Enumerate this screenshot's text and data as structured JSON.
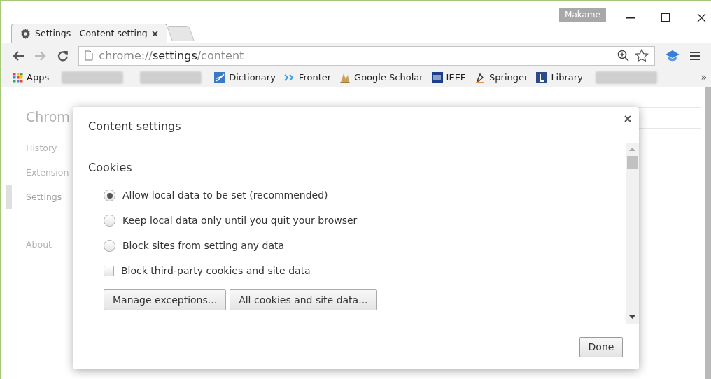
{
  "window": {
    "profile": "Makame"
  },
  "tab": {
    "title": "Settings - Content setting"
  },
  "address": {
    "scheme": "chrome://",
    "host": "settings",
    "path": "/content"
  },
  "bookmarks": [
    {
      "kind": "apps",
      "label": "Apps"
    },
    {
      "kind": "redacted"
    },
    {
      "kind": "redacted"
    },
    {
      "kind": "link",
      "label": "Dictionary"
    },
    {
      "kind": "link",
      "label": "Fronter"
    },
    {
      "kind": "link",
      "label": "Google Scholar"
    },
    {
      "kind": "link",
      "label": "IEEE"
    },
    {
      "kind": "link",
      "label": "Springer"
    },
    {
      "kind": "link",
      "label": "Library"
    },
    {
      "kind": "redacted"
    }
  ],
  "bookmarks_more": "»",
  "page": {
    "title": "Chrom",
    "nav": [
      {
        "label": "History",
        "selected": false
      },
      {
        "label": "Extension",
        "selected": false
      },
      {
        "label": "Settings",
        "selected": true
      },
      {
        "label": "About",
        "selected": false
      }
    ]
  },
  "dialog": {
    "title": "Content settings",
    "section": "Cookies",
    "options": [
      {
        "kind": "radio",
        "label": "Allow local data to be set (recommended)",
        "selected": true
      },
      {
        "kind": "radio",
        "label": "Keep local data only until you quit your browser",
        "selected": false
      },
      {
        "kind": "radio",
        "label": "Block sites from setting any data",
        "selected": false
      },
      {
        "kind": "checkbox",
        "label": "Block third-party cookies and site data",
        "checked": false
      }
    ],
    "buttons": [
      "Manage exceptions...",
      "All cookies and site data..."
    ],
    "done": "Done"
  }
}
